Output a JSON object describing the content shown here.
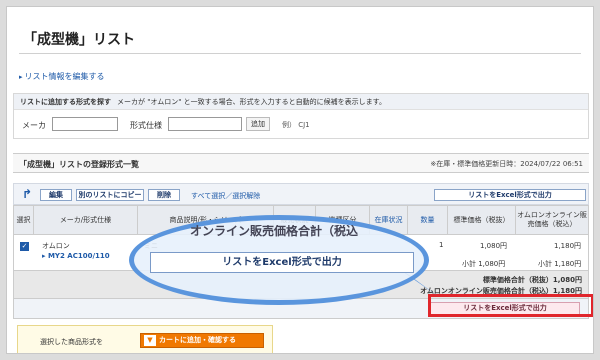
{
  "page": {
    "title": "「成型機」リスト"
  },
  "edit_link": "リスト情報を編集する",
  "search": {
    "heading": "リストに追加する形式を探す",
    "hint": "メーカが \"オムロン\" と一致する場合、形式を入力すると自動的に候補を表示します。",
    "maker_label": "メーカ",
    "model_label": "形式仕様",
    "add_button": "追加",
    "example": "例） CJ1"
  },
  "list": {
    "title": "「成型機」リストの登録形式一覧",
    "note": "※在庫・標準価格更新日時：2024/07/22 06:51"
  },
  "toolbar": {
    "edit": "編集",
    "copy": "別のリストにコピー",
    "delete": "削除",
    "select_all": "すべて選択／選択解除",
    "excel": "リストをExcel形式で出力"
  },
  "table": {
    "headers": [
      "選択",
      "メーカ/形式仕様",
      "商品説明/形・シリーズ",
      "販売状況",
      "機種区分",
      "在庫状況",
      "数量",
      "標準価格（税抜）",
      "オムロンオンライン販売価格（税込）"
    ],
    "rows": [
      {
        "maker": "オムロン",
        "model": "MY2 AC100/110",
        "description": "ミニ",
        "quantity": "1",
        "std_price": "1,080円",
        "online_price": "1,180円",
        "std_subtotal": "小計 1,080円",
        "online_subtotal": "小計 1,180円"
      }
    ],
    "total_std": "標準価格合計（税抜）1,080円",
    "total_online": "オムロンオンライン販売価格合計（税込）1,180円",
    "excel_bottom": "リストをExcel形式で出力"
  },
  "cart": {
    "label": "選択した商品形式を",
    "button": "カートに追加・確認する"
  },
  "callout": {
    "partial_text": "オンライン販売価格合計（税込",
    "button": "リストをExcel形式で出力"
  },
  "colors": {
    "accent": "#1e5aa8",
    "highlight": "#e0262c",
    "callout": "#5a95dd",
    "cart": "#f07800"
  }
}
